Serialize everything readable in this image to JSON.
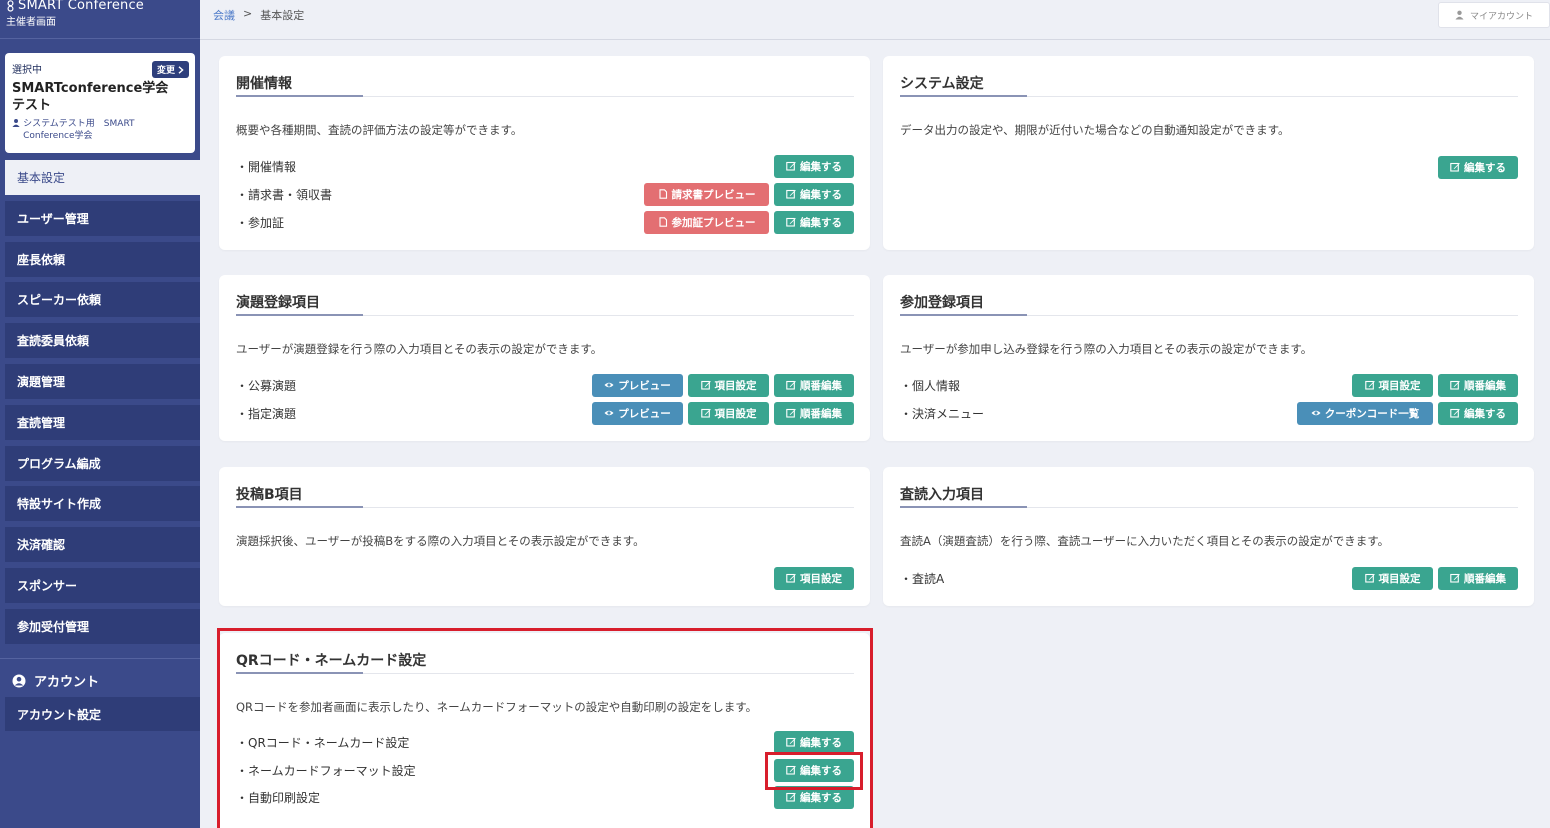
{
  "brand": {
    "title": "SMART Conference",
    "subtitle": "主催者画面"
  },
  "selected": {
    "label": "選択中",
    "change_label": "変更",
    "name": "SMARTconference学会　テスト",
    "user": "システムテスト用　SMART Conference学会"
  },
  "nav": [
    "基本設定",
    "ユーザー管理",
    "座長依頼",
    "スピーカー依頼",
    "査読委員依頼",
    "演題管理",
    "査読管理",
    "プログラム編成",
    "特設サイト作成",
    "決済確認",
    "スポンサー",
    "参加受付管理"
  ],
  "account": {
    "heading": "アカウント",
    "settings": "アカウント設定",
    "my_account": "マイアカウント"
  },
  "breadcrumb": {
    "link": "会議",
    "sep": ">",
    "current": "基本設定"
  },
  "cards": {
    "kaisai": {
      "title": "開催情報",
      "desc": "概要や各種期間、査読の評価方法の設定等ができます。",
      "rows": [
        "・開催情報",
        "・請求書・領収書",
        "・参加証"
      ]
    },
    "system": {
      "title": "システム設定",
      "desc": "データ出力の設定や、期限が近付いた場合などの自動通知設定ができます。"
    },
    "endai": {
      "title": "演題登録項目",
      "desc": "ユーザーが演題登録を行う際の入力項目とその表示の設定ができます。",
      "rows": [
        "・公募演題",
        "・指定演題"
      ]
    },
    "sanka": {
      "title": "参加登録項目",
      "desc": "ユーザーが参加申し込み登録を行う際の入力項目とその表示の設定ができます。",
      "rows": [
        "・個人情報",
        "・決済メニュー"
      ]
    },
    "toukou": {
      "title": "投稿B項目",
      "desc": "演題採択後、ユーザーが投稿Bをする際の入力項目とその表示設定ができます。"
    },
    "sadoku": {
      "title": "査読入力項目",
      "desc": "査読A（演題査読）を行う際、査読ユーザーに入力いただく項目とその表示の設定ができます。",
      "rows": [
        "・査読A"
      ]
    },
    "qr": {
      "title": "QRコード・ネームカード設定",
      "desc": "QRコードを参加者画面に表示したり、ネームカードフォーマットの設定や自動印刷の設定をします。",
      "rows": [
        "・QRコード・ネームカード設定",
        "・ネームカードフォーマット設定",
        "・自動印刷設定"
      ]
    }
  },
  "buttons": {
    "edit": "編集する",
    "invoice_preview": "請求書プレビュー",
    "cert_preview": "参加証プレビュー",
    "preview": "プレビュー",
    "item_settings": "項目設定",
    "order_edit": "順番編集",
    "coupon_list": "クーポンコード一覧"
  },
  "colors": {
    "sidebar": "#3b4a8a",
    "teal": "#3aa590",
    "pink": "#e36f72",
    "blue": "#4a8fb8",
    "highlight": "#d81e2c"
  }
}
